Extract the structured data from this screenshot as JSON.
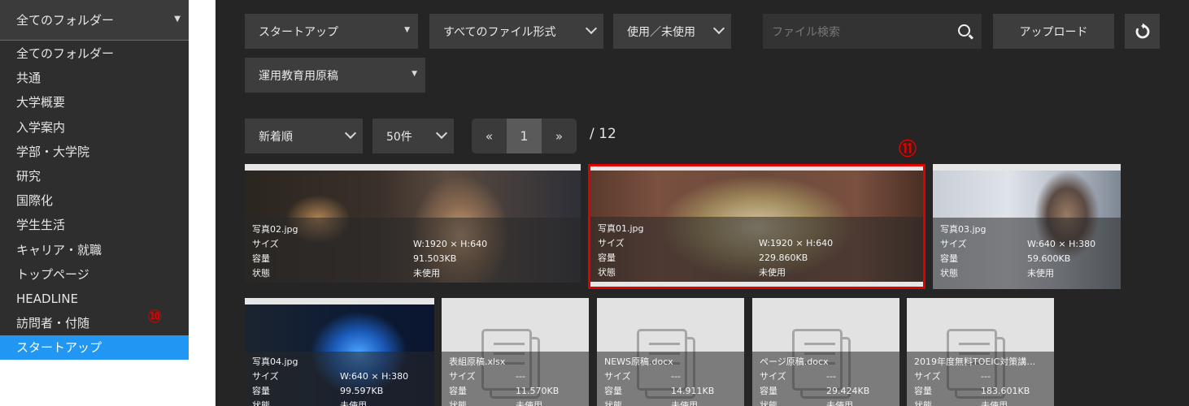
{
  "sidebar": {
    "folder_select": "全てのフォルダー",
    "items": [
      {
        "label": "全てのフォルダー"
      },
      {
        "label": "共通"
      },
      {
        "label": "大学概要"
      },
      {
        "label": "入学案内"
      },
      {
        "label": "学部・大学院"
      },
      {
        "label": "研究"
      },
      {
        "label": "国際化"
      },
      {
        "label": "学生生活"
      },
      {
        "label": "キャリア・就職"
      },
      {
        "label": "トップページ"
      },
      {
        "label": "HEADLINE"
      },
      {
        "label": "訪問者・付随"
      },
      {
        "label": "スタートアップ"
      }
    ],
    "active_index": 12
  },
  "markers": {
    "m10": "⑩",
    "m11": "⑪"
  },
  "filters": {
    "folder": "スタートアップ",
    "file_type": "すべてのファイル形式",
    "usage": "使用／未使用",
    "subfolder": "運用教育用原稿",
    "search_placeholder": "ファイル検索",
    "upload": "アップロード"
  },
  "sort": {
    "order": "新着順",
    "per_page": "50件"
  },
  "pagination": {
    "prev": "«",
    "current": "1",
    "next": "»",
    "total": "/ 12"
  },
  "labels": {
    "size": "サイズ",
    "capacity": "容量",
    "status": "状態"
  },
  "files": [
    {
      "name": "写真02.jpg",
      "size": "W:1920 × H:640",
      "capacity": "91.503KB",
      "status": "未使用"
    },
    {
      "name": "写真01.jpg",
      "size": "W:1920 × H:640",
      "capacity": "229.860KB",
      "status": "未使用"
    },
    {
      "name": "写真03.jpg",
      "size": "W:640 × H:380",
      "capacity": "59.600KB",
      "status": "未使用"
    },
    {
      "name": "写真04.jpg",
      "size": "W:640 × H:380",
      "capacity": "99.597KB",
      "status": "未使用"
    },
    {
      "name": "表組原稿.xlsx",
      "size": "---",
      "capacity": "11.570KB",
      "status": "未使用"
    },
    {
      "name": "NEWS原稿.docx",
      "size": "---",
      "capacity": "14.911KB",
      "status": "未使用"
    },
    {
      "name": "ページ原稿.docx",
      "size": "---",
      "capacity": "29.424KB",
      "status": "未使用"
    },
    {
      "name": "2019年度無料TOEIC対策講…",
      "size": "---",
      "capacity": "183.601KB",
      "status": "未使用"
    }
  ],
  "colors": {
    "highlight": "#e00000",
    "active": "#2196f3",
    "panel": "#252525"
  }
}
